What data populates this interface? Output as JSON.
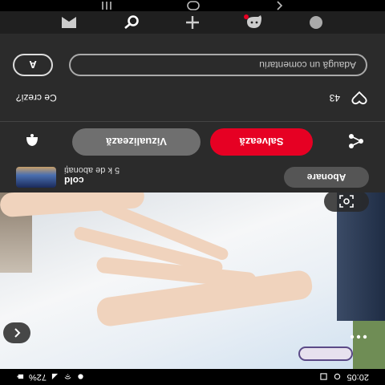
{
  "status_bar": {
    "time": "20:05",
    "battery": "72%"
  },
  "pin": {
    "creator_name": "cold",
    "creator_subscribers": "5 k de abonați",
    "subscribe_label": "Abonare",
    "view_label": "Vizualizează",
    "save_label": "Salvează"
  },
  "comments": {
    "question": "Ce crezi?",
    "count": "43",
    "user_initial": "A",
    "input_placeholder": "Adaugă un comentariu"
  },
  "icons": {
    "back": "chevron-left-icon",
    "more": "more-dots-icon",
    "lens": "lens-scan-icon",
    "share": "share-icon",
    "bell": "notification-icon",
    "heart": "heart-icon",
    "nav": [
      "profile-icon",
      "messages-icon",
      "create-icon",
      "search-icon",
      "home-icon"
    ]
  },
  "colors": {
    "accent": "#e60023",
    "panel": "#2b2b2b",
    "secondary_button": "#6f6f6f"
  }
}
